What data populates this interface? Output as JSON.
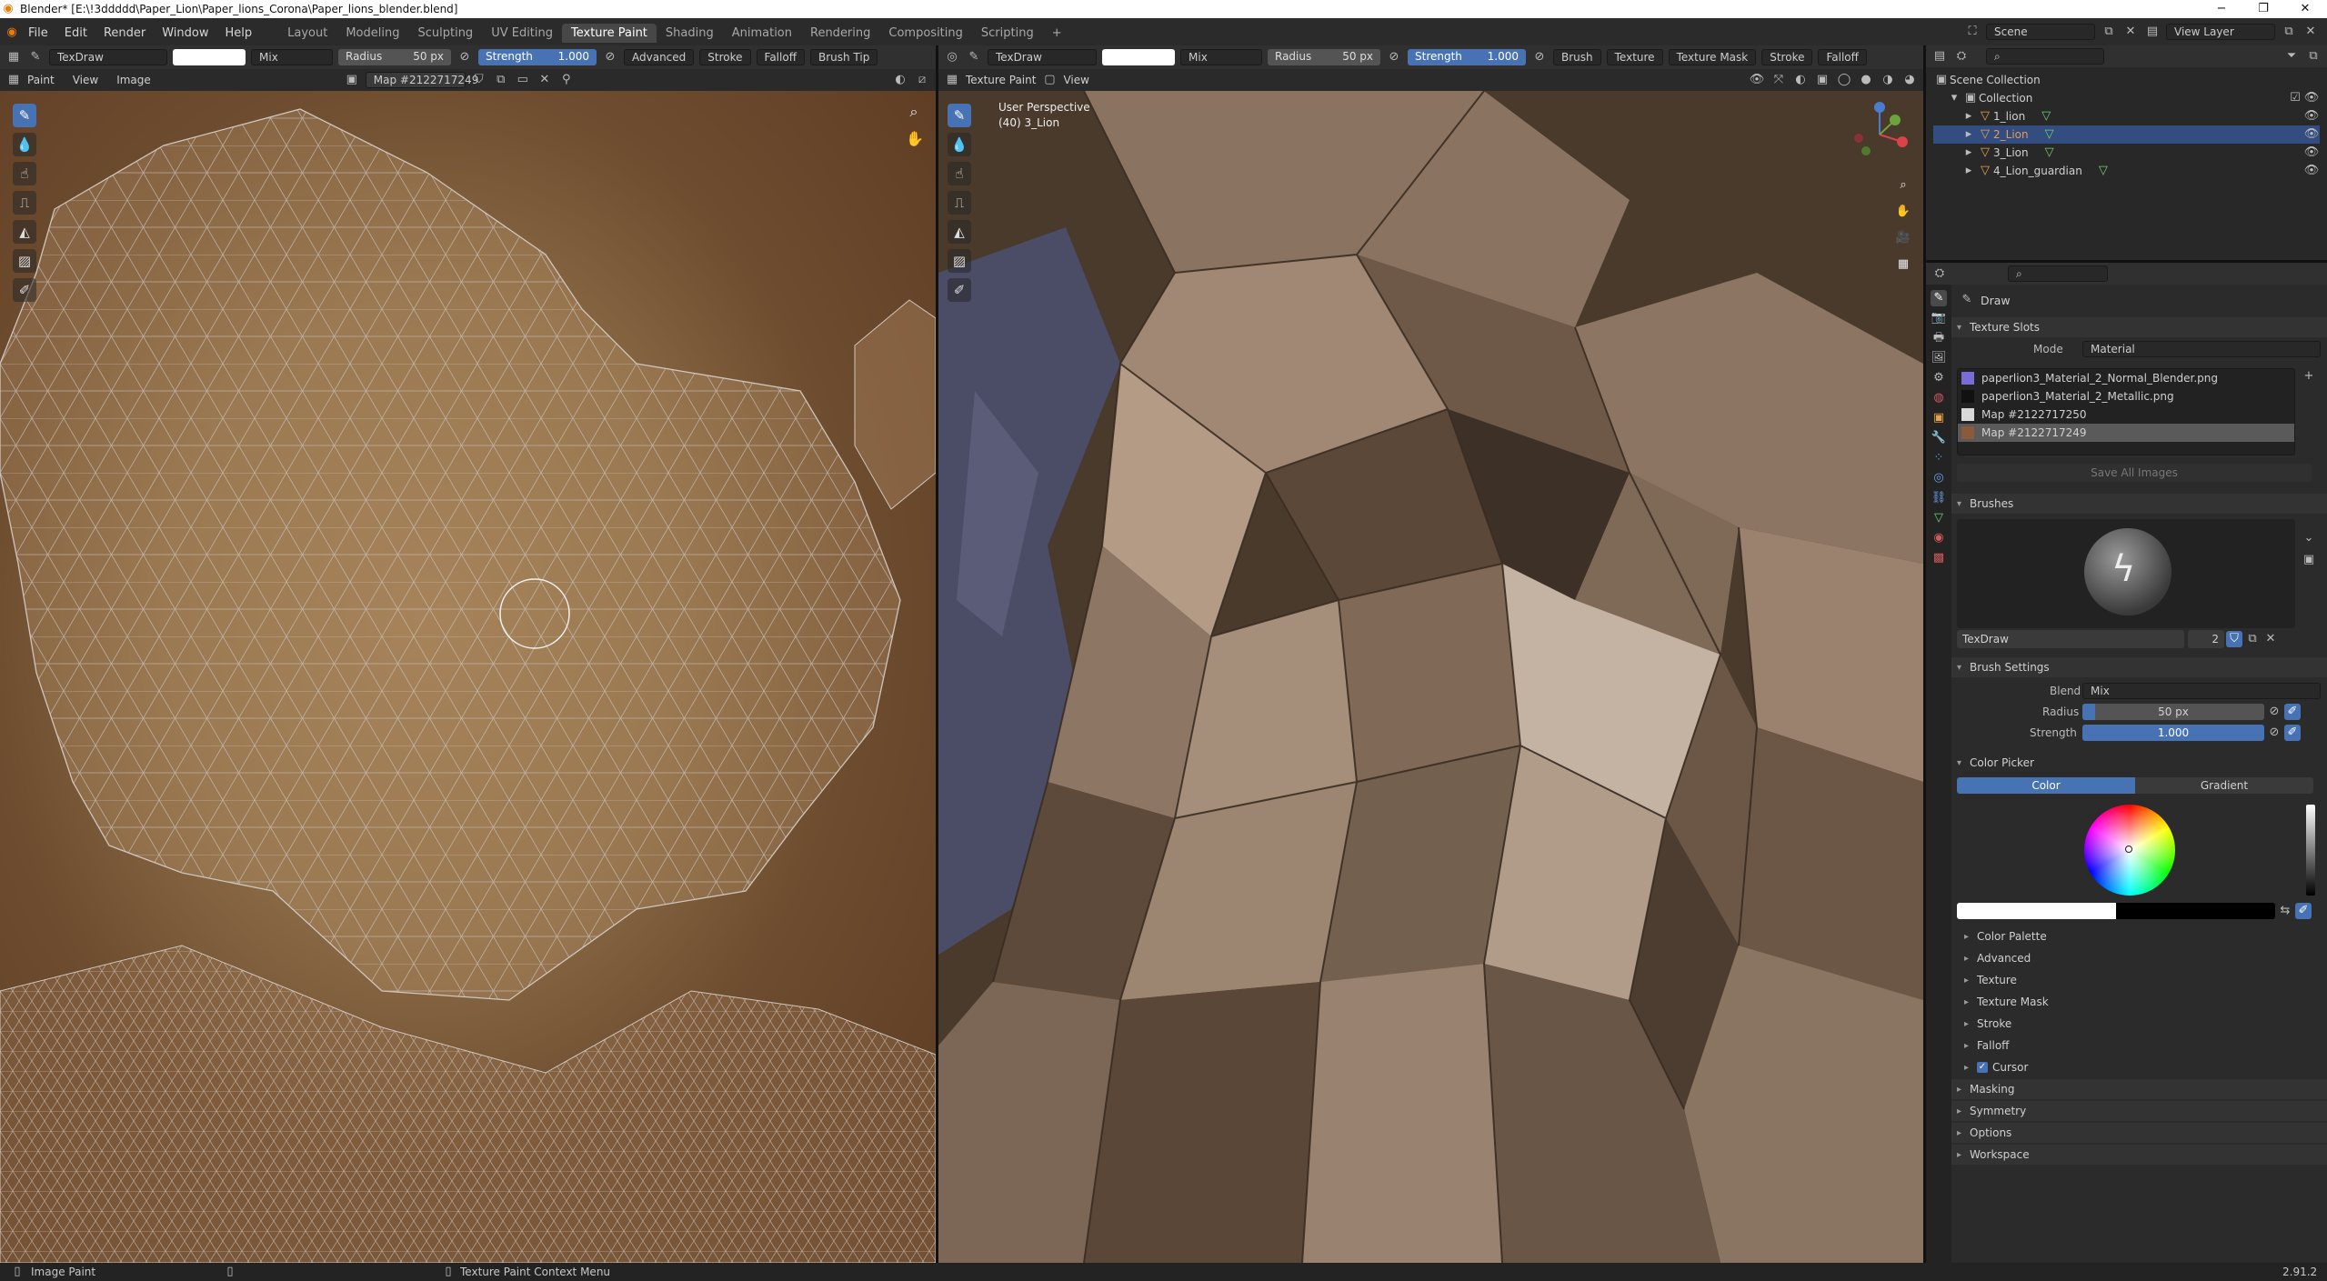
{
  "window": {
    "title": "Blender* [E:\\!3ddddd\\Paper_Lion\\Paper_lions_Corona\\Paper_lions_blender.blend]",
    "minimize": "−",
    "maximize": "❐",
    "close": "✕"
  },
  "menubar": {
    "items": [
      "File",
      "Edit",
      "Render",
      "Window",
      "Help"
    ]
  },
  "workspaces": {
    "tabs": [
      "Layout",
      "Modeling",
      "Sculpting",
      "UV Editing",
      "Texture Paint",
      "Shading",
      "Animation",
      "Rendering",
      "Compositing",
      "Scripting"
    ],
    "active": "Texture Paint",
    "add": "+"
  },
  "scene": {
    "name": "Scene",
    "view_layer": "View Layer"
  },
  "left_tool_header": {
    "brush": "TexDraw",
    "blend": "Mix",
    "radius_label": "Radius",
    "radius_value": "50 px",
    "strength_label": "Strength",
    "strength_value": "1.000",
    "advanced": "Advanced",
    "stroke": "Stroke",
    "falloff": "Falloff",
    "brush_tip": "Brush Tip"
  },
  "left_view_header": {
    "mode": "Paint",
    "view": "View",
    "image": "Image",
    "map_name": "Map #2122717249"
  },
  "right_tool_header": {
    "brush": "Brush",
    "blend": "Mix",
    "radius_label": "Radius",
    "radius_value": "50 px",
    "strength_label": "Strength",
    "strength_value": "1.000",
    "texture": "Texture",
    "texture_mask": "Texture Mask",
    "stroke": "Stroke",
    "falloff": "Falloff",
    "brush_name": "TexDraw"
  },
  "right_view_header": {
    "mode": "Texture Paint",
    "view": "View"
  },
  "viewport_overlay": {
    "perspective": "User Perspective",
    "object": "(40) 3_Lion"
  },
  "outliner": {
    "root": "Scene Collection",
    "collection": "Collection",
    "items": [
      {
        "name": "1_lion",
        "selected": false
      },
      {
        "name": "2_Lion",
        "selected": true
      },
      {
        "name": "3_Lion",
        "selected": false
      },
      {
        "name": "4_Lion_guardian",
        "selected": false
      }
    ]
  },
  "properties": {
    "tool_name": "Draw",
    "texture_slots": {
      "title": "Texture Slots",
      "mode_label": "Mode",
      "mode_value": "Material",
      "slots": [
        {
          "name": "paperlion3_Material_2_Normal_Blender.png",
          "color": "#7a6cd8"
        },
        {
          "name": "paperlion3_Material_2_Metallic.png",
          "color": "#111111"
        },
        {
          "name": "Map #2122717250",
          "color": "#d8d8d8"
        },
        {
          "name": "Map #2122717249",
          "color": "#8b5a3a"
        }
      ],
      "save_all": "Save All Images"
    },
    "brushes": {
      "title": "Brushes",
      "brush_name": "TexDraw",
      "users": "2"
    },
    "brush_settings": {
      "title": "Brush Settings",
      "blend_label": "Blend",
      "blend_value": "Mix",
      "radius_label": "Radius",
      "radius_value": "50 px",
      "strength_label": "Strength",
      "strength_value": "1.000"
    },
    "color_picker": {
      "title": "Color Picker",
      "tab_color": "Color",
      "tab_gradient": "Gradient"
    },
    "subpanels": [
      "Color Palette",
      "Advanced",
      "Texture",
      "Texture Mask",
      "Stroke",
      "Falloff",
      "Cursor"
    ],
    "panels": [
      "Masking",
      "Symmetry",
      "Options",
      "Workspace"
    ]
  },
  "statusbar": {
    "left": "Image Paint",
    "center": "Texture Paint Context Menu",
    "version": "2.91.2"
  }
}
